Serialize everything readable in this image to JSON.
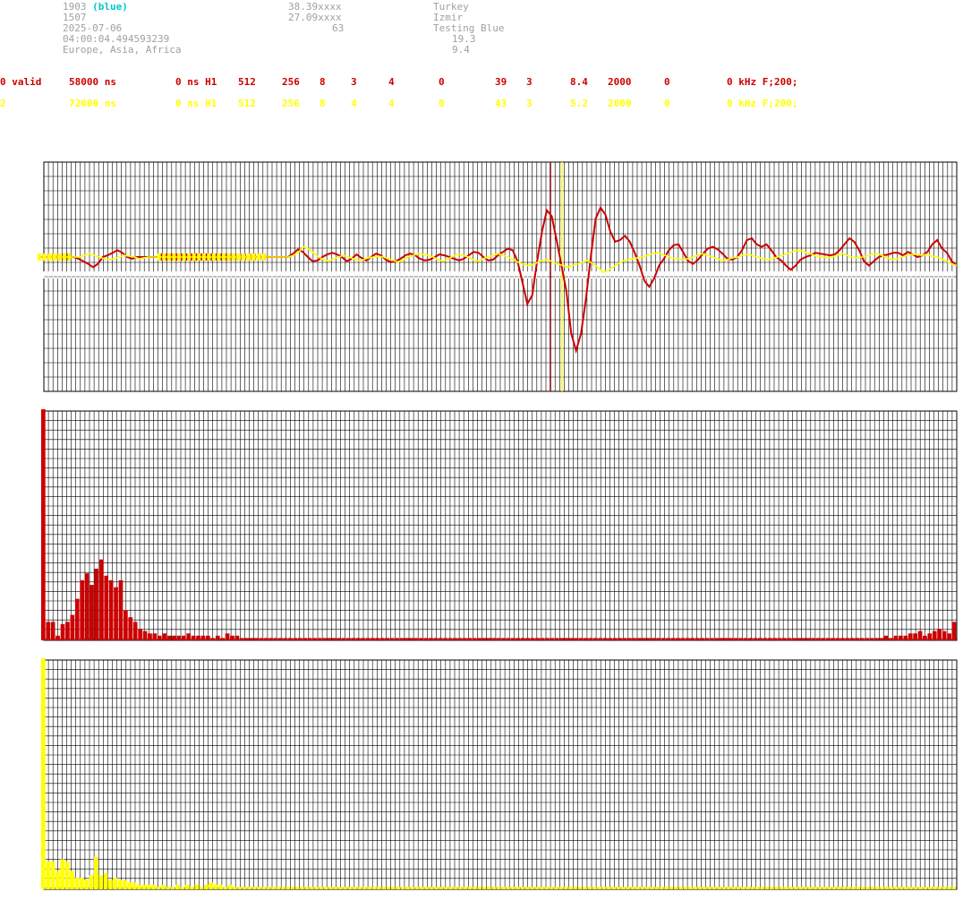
{
  "header": {
    "station_id": "1903",
    "station_tag": "(blue)",
    "number": "1507",
    "date": "2025-07-06",
    "time": "04:00:04.494593239",
    "region": "Europe, Asia, Africa",
    "lat": "38.39xxxx",
    "lon": "27.09xxxx",
    "alt": "63",
    "country": "Turkey",
    "city": "Izmir",
    "status": "Testing Blue",
    "val1": "19.3",
    "val2": "9.4"
  },
  "rows": [
    {
      "color": "#cc0000",
      "cells": [
        "0 valid",
        "58000 ns",
        "0 ns H1",
        "512",
        "256",
        "8",
        "3",
        "4",
        "0",
        "39",
        "3",
        "8.4",
        "2000",
        "0",
        "0 kHz F;200;"
      ]
    },
    {
      "color": "#ffff00",
      "cells": [
        "2",
        "72000 ns",
        "0 ns H1",
        "512",
        "256",
        "8",
        "4",
        "4",
        "0",
        "43",
        "3",
        "5.2",
        "2000",
        "0",
        "0 kHz F;200;"
      ]
    }
  ],
  "chart_data": [
    {
      "type": "line",
      "series": [
        {
          "color": "#cc0000",
          "values": [
            0,
            0,
            0,
            0,
            0,
            0,
            0,
            0,
            -2,
            -5,
            -8,
            -12,
            -8,
            0,
            2,
            5,
            8,
            5,
            0,
            -2,
            0,
            0,
            0,
            0,
            0,
            0,
            0,
            0,
            0,
            0,
            0,
            0,
            0,
            0,
            0,
            0,
            0,
            0,
            0,
            0,
            0,
            0,
            0,
            0,
            0,
            0,
            0,
            0,
            0,
            0,
            0,
            0,
            4,
            9,
            6,
            0,
            -5,
            -4,
            0,
            3,
            5,
            3,
            0,
            -5,
            -2,
            3,
            -1,
            -4,
            0,
            4,
            2,
            -3,
            -6,
            -5,
            -2,
            2,
            4,
            2,
            -2,
            -4,
            -3,
            0,
            3,
            2,
            0,
            -2,
            -4,
            -2,
            2,
            6,
            5,
            0,
            -4,
            -3,
            2,
            6,
            10,
            8,
            -5,
            -30,
            -55,
            -45,
            -5,
            30,
            55,
            48,
            20,
            -10,
            -40,
            -90,
            -110,
            -90,
            -50,
            0,
            45,
            58,
            50,
            30,
            18,
            20,
            25,
            18,
            5,
            -10,
            -28,
            -35,
            -25,
            -10,
            -2,
            8,
            14,
            15,
            5,
            -5,
            -8,
            -3,
            4,
            10,
            12,
            9,
            4,
            -2,
            -3,
            0,
            8,
            20,
            22,
            15,
            12,
            15,
            8,
            0,
            -4,
            -10,
            -15,
            -10,
            -3,
            0,
            2,
            5,
            4,
            3,
            2,
            3,
            8,
            15,
            22,
            18,
            8,
            -5,
            -10,
            -5,
            0,
            2,
            3,
            5,
            5,
            2,
            6,
            3,
            0,
            2,
            6,
            15,
            20,
            10,
            5,
            -5,
            -10
          ]
        },
        {
          "color": "#ffff00",
          "values": [
            0,
            0,
            0,
            0,
            0,
            0,
            0,
            0,
            0,
            2,
            4,
            2,
            0,
            -2,
            -3,
            -2,
            0,
            2,
            1,
            0,
            -2,
            -1,
            0,
            0,
            0,
            0,
            0,
            0,
            0,
            0,
            0,
            0,
            0,
            0,
            0,
            0,
            0,
            0,
            0,
            0,
            0,
            0,
            0,
            0,
            0,
            0,
            0,
            0,
            0,
            0,
            0,
            2,
            6,
            12,
            10,
            5,
            0,
            -3,
            -5,
            -2,
            0,
            2,
            0,
            -2,
            -4,
            -3,
            -1,
            0,
            1,
            0,
            -2,
            -4,
            -6,
            -3,
            0,
            2,
            4,
            3,
            2,
            0,
            -3,
            -5,
            -2,
            1,
            3,
            2,
            0,
            -3,
            -5,
            -2,
            0,
            2,
            4,
            2,
            0,
            -3,
            -6,
            -8,
            -10,
            -9,
            -6,
            -4,
            -3,
            -6,
            -8,
            -10,
            -12,
            -10,
            -8,
            -6,
            -4,
            -8,
            -12,
            -18,
            -16,
            -12,
            -8,
            -5,
            -3,
            -2,
            -1,
            0,
            2,
            4,
            5,
            3,
            1,
            -1,
            -2,
            -3,
            -2,
            0,
            2,
            4,
            2,
            0,
            -2,
            -4,
            -3,
            -1,
            0,
            2,
            3,
            2,
            0,
            -2,
            -3,
            -2,
            0,
            2,
            4,
            6,
            8,
            7,
            5,
            3,
            1,
            0,
            -1,
            0,
            2,
            4,
            2,
            0,
            -1,
            0,
            1,
            3,
            4,
            2,
            -1,
            -3,
            -2,
            0,
            2,
            3,
            3,
            2,
            3,
            1,
            0,
            -2,
            -5,
            -8,
            -10
          ]
        }
      ]
    },
    {
      "type": "bar",
      "series": [
        {
          "color": "#cc0000",
          "values": [
            100,
            8,
            8,
            2,
            7,
            8,
            11,
            18,
            26,
            29,
            24,
            31,
            35,
            28,
            26,
            23,
            26,
            13,
            10,
            8,
            5,
            4,
            3,
            3,
            2,
            3,
            2,
            2,
            2,
            2,
            3,
            2,
            2,
            2,
            2,
            1,
            2,
            1,
            3,
            2,
            2,
            1,
            1,
            1,
            1,
            1,
            1,
            1,
            1,
            1,
            1,
            1,
            1,
            1,
            1,
            1,
            1,
            1,
            1,
            1,
            1,
            1,
            1,
            1,
            1,
            1,
            1,
            1,
            1,
            1,
            1,
            1,
            1,
            1,
            1,
            1,
            1,
            1,
            1,
            1,
            1,
            1,
            1,
            1,
            1,
            1,
            1,
            1,
            1,
            1,
            1,
            1,
            1,
            1,
            1,
            1,
            1,
            1,
            1,
            1,
            1,
            1,
            1,
            1,
            1,
            1,
            1,
            1,
            1,
            1,
            1,
            1,
            1,
            1,
            1,
            1,
            1,
            1,
            1,
            1,
            1,
            1,
            1,
            1,
            1,
            1,
            1,
            1,
            1,
            1,
            1,
            1,
            1,
            1,
            1,
            1,
            1,
            1,
            1,
            1,
            1,
            1,
            1,
            1,
            1,
            1,
            1,
            1,
            1,
            1,
            1,
            1,
            1,
            1,
            1,
            1,
            1,
            1,
            1,
            1,
            1,
            1,
            1,
            1,
            1,
            1,
            1,
            1,
            1,
            1,
            1,
            1,
            1,
            1,
            2,
            1,
            2,
            2,
            2,
            3,
            3,
            4,
            2,
            3,
            4,
            5,
            4,
            3,
            8
          ]
        }
      ]
    },
    {
      "type": "bar",
      "series": [
        {
          "color": "#ffff00",
          "values": [
            100,
            12,
            12,
            8,
            13,
            12,
            8,
            5,
            5,
            4,
            6,
            14,
            6,
            7,
            4,
            5,
            4,
            4,
            3,
            3,
            2,
            2,
            2,
            2,
            1,
            2,
            1,
            1,
            2,
            1,
            2,
            1,
            2,
            1,
            2,
            3,
            2,
            2,
            1,
            2,
            1,
            1,
            1,
            1,
            1,
            1,
            1,
            1,
            1,
            1,
            1,
            1,
            1,
            1,
            1,
            1,
            1,
            1,
            1,
            1,
            1,
            1,
            1,
            1,
            1,
            1,
            1,
            1,
            1,
            1,
            1,
            1,
            1,
            1,
            1,
            1,
            1,
            1,
            1,
            1,
            1,
            1,
            1,
            1,
            1,
            1,
            1,
            1,
            1,
            1,
            1,
            1,
            1,
            1,
            1,
            1,
            1,
            1,
            1,
            1,
            1,
            1,
            1,
            1,
            1,
            1,
            1,
            1,
            1,
            1,
            1,
            1,
            1,
            1,
            1,
            1,
            1,
            1,
            1,
            1,
            1,
            1,
            1,
            1,
            1,
            1,
            1,
            1,
            1,
            1,
            1,
            1,
            1,
            1,
            1,
            1,
            1,
            1,
            1,
            1,
            1,
            1,
            1,
            1,
            1,
            1,
            1,
            1,
            1,
            1,
            1,
            1,
            1,
            1,
            1,
            1,
            1,
            1,
            1,
            1,
            1,
            1,
            1,
            1,
            1,
            1,
            1,
            1,
            1,
            1,
            1,
            1,
            1,
            1,
            1,
            1,
            1,
            1,
            1,
            1,
            1,
            1,
            1,
            1,
            1,
            1,
            1,
            1,
            1,
            1,
            1
          ]
        }
      ]
    }
  ]
}
